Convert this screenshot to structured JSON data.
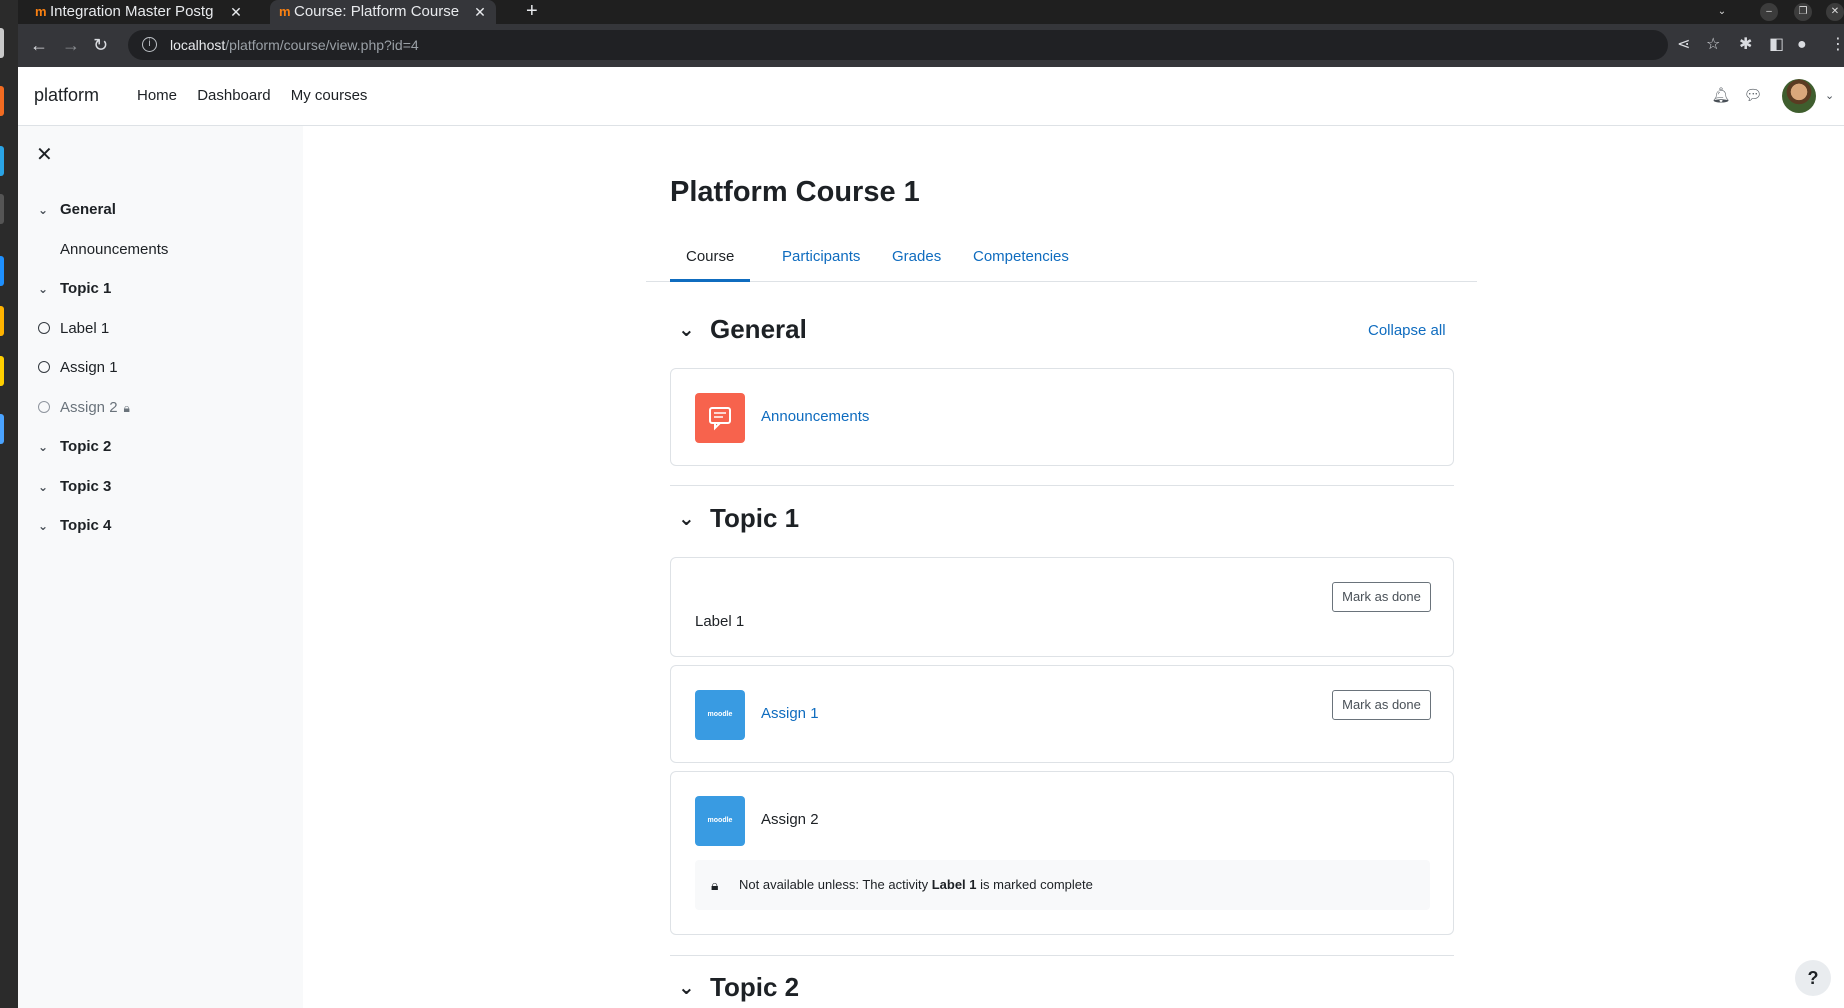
{
  "browser": {
    "tabs": [
      {
        "favicon": "m",
        "title": "Integration Master Postg"
      },
      {
        "favicon": "m",
        "title": "Course: Platform Course"
      }
    ],
    "url_host": "localhost",
    "url_path": "/platform/course/view.php?id=4"
  },
  "navbar": {
    "brand": "platform",
    "links": [
      "Home",
      "Dashboard",
      "My courses"
    ]
  },
  "course_index": {
    "items": [
      {
        "type": "section",
        "label": "General"
      },
      {
        "type": "activity",
        "label": "Announcements",
        "marker": "none"
      },
      {
        "type": "section",
        "label": "Topic 1"
      },
      {
        "type": "activity",
        "label": "Label 1",
        "marker": "circle"
      },
      {
        "type": "activity",
        "label": "Assign 1",
        "marker": "circle"
      },
      {
        "type": "activity",
        "label": "Assign 2",
        "marker": "circle",
        "locked": true
      },
      {
        "type": "section",
        "label": "Topic 2"
      },
      {
        "type": "section",
        "label": "Topic 3"
      },
      {
        "type": "section",
        "label": "Topic 4"
      }
    ]
  },
  "page": {
    "title": "Platform Course 1",
    "tabs": [
      "Course",
      "Participants",
      "Grades",
      "Competencies"
    ],
    "active_tab": "Course",
    "collapse_all": "Collapse all"
  },
  "sections": {
    "general": {
      "title": "General",
      "announcements": "Announcements"
    },
    "topic1": {
      "title": "Topic 1",
      "label1": "Label 1",
      "assign1": "Assign 1",
      "assign2": "Assign 2",
      "mark_done": "Mark as done",
      "restriction_prefix": "Not available unless: The activity",
      "restriction_activity": "Label 1",
      "restriction_suffix": "is marked complete"
    },
    "topic2": {
      "title": "Topic 2"
    }
  },
  "help": "?",
  "colors": {
    "link": "#0f6cbf",
    "forum_icon": "#f7634d",
    "assign_icon": "#399be2"
  }
}
